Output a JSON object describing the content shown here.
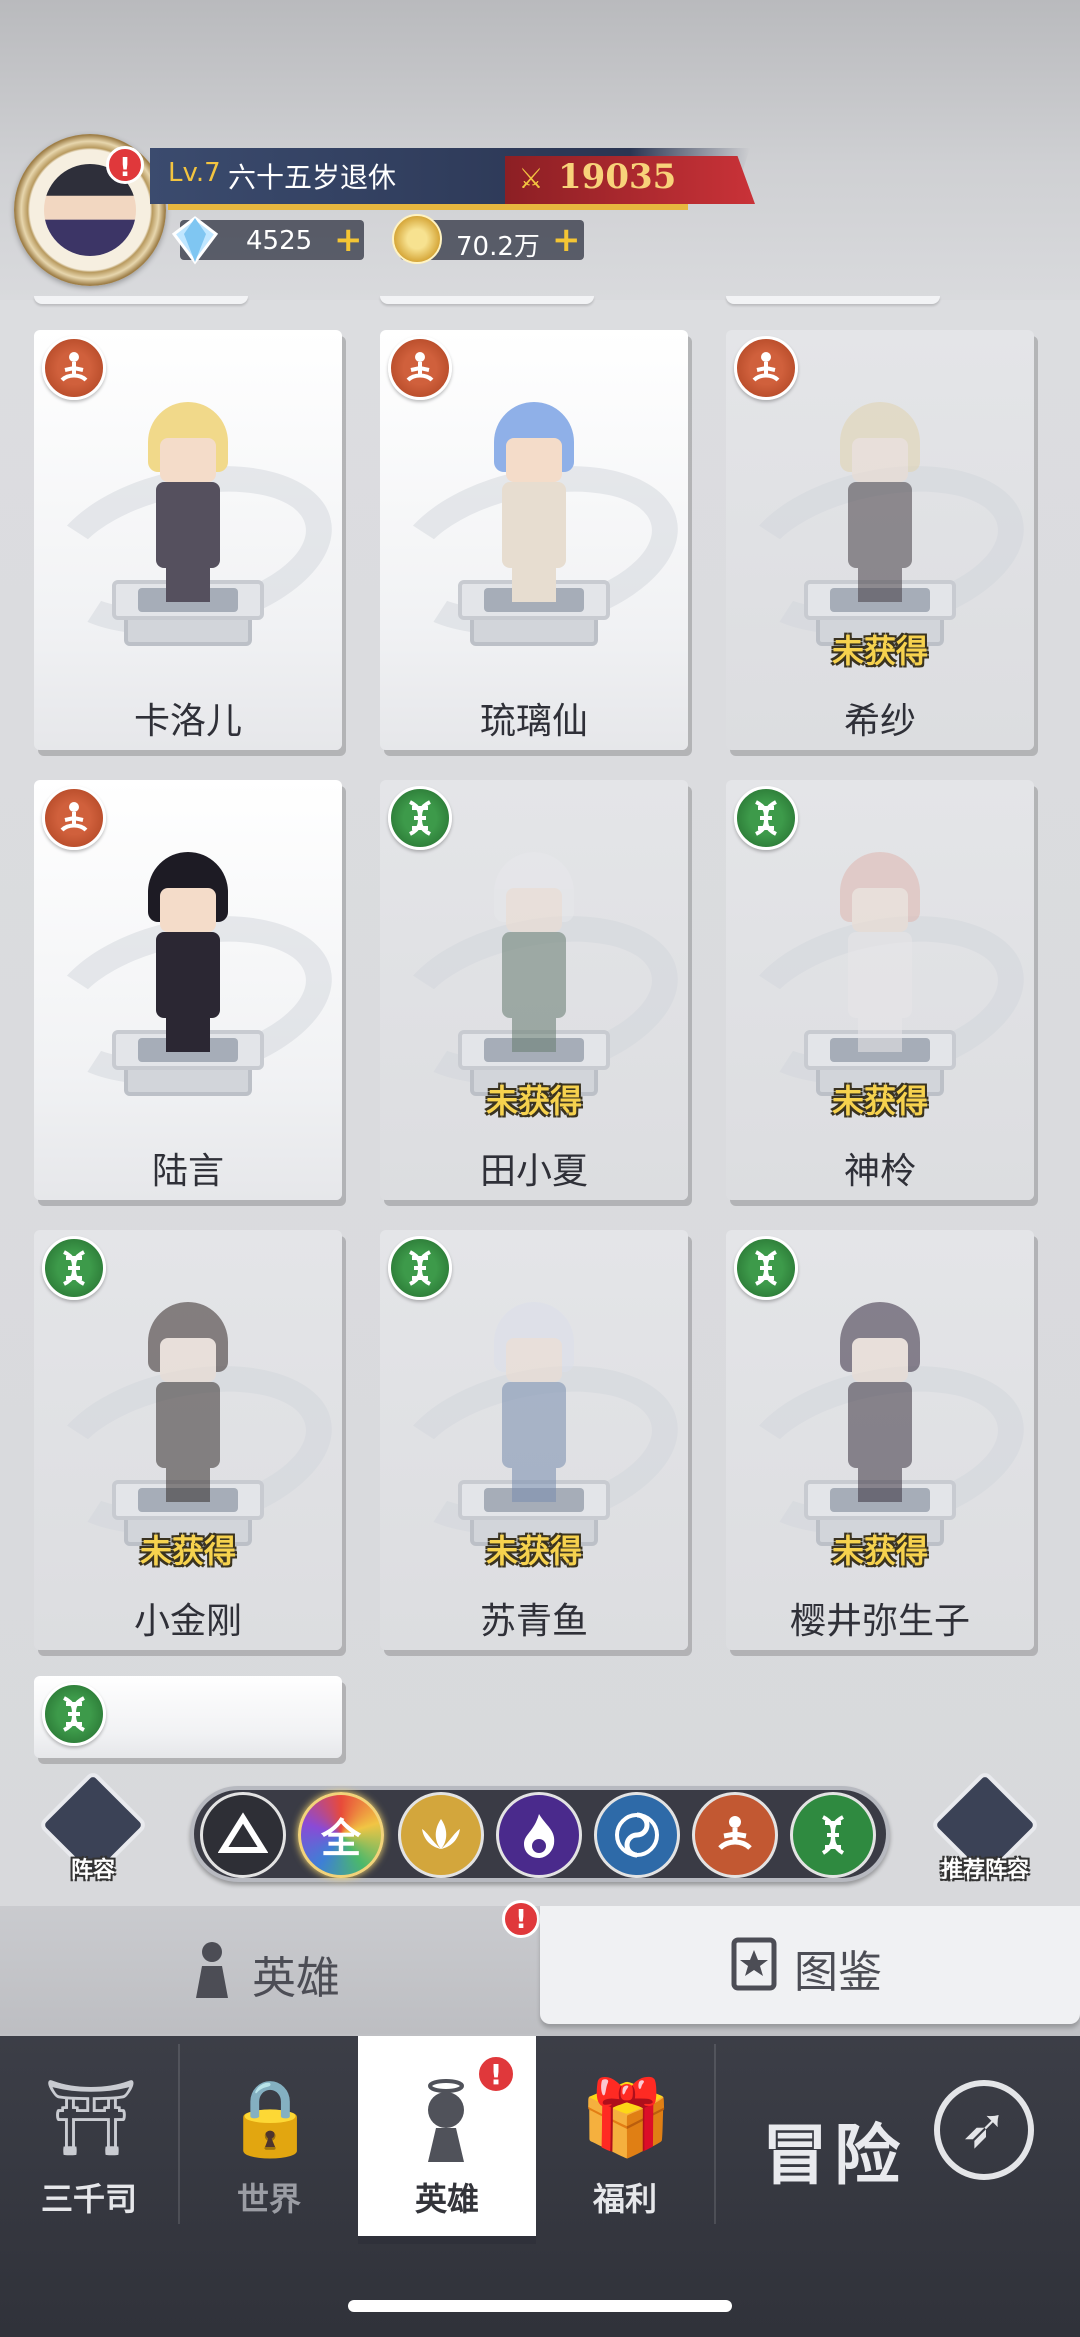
{
  "player": {
    "level": "Lv.7",
    "name": "六十五岁退休",
    "power": "19035",
    "alert": "!",
    "diamonds": "4525",
    "gold": "70.2万",
    "plus": "+"
  },
  "heroes": [
    {
      "name": "卡洛儿",
      "faction": "fire",
      "status": "",
      "locked": false,
      "hair": "#f1d98a",
      "outfit": "#55505e"
    },
    {
      "name": "琉璃仙",
      "faction": "fire",
      "status": "",
      "locked": false,
      "hair": "#8fb0e8",
      "outfit": "#e7ddd0"
    },
    {
      "name": "希纱",
      "faction": "fire",
      "status": "未获得",
      "locked": true,
      "hair": "#e8d39b",
      "outfit": "#4a3f49"
    },
    {
      "name": "陆言",
      "faction": "fire",
      "status": "",
      "locked": false,
      "hair": "#1d1b24",
      "outfit": "#2b2733"
    },
    {
      "name": "田小夏",
      "faction": "dna",
      "status": "未获得",
      "locked": true,
      "hair": "#e6e8ec",
      "outfit": "#5e7f6c"
    },
    {
      "name": "神柃",
      "faction": "dna",
      "status": "未获得",
      "locked": true,
      "hair": "#f0b3a7",
      "outfit": "#e9e6ea"
    },
    {
      "name": "小金刚",
      "faction": "dna",
      "status": "未获得",
      "locked": true,
      "hair": "#3b2a28",
      "outfit": "#3a2f2e"
    },
    {
      "name": "苏青鱼",
      "faction": "dna",
      "status": "未获得",
      "locked": true,
      "hair": "#d9dff0",
      "outfit": "#6f8fc2"
    },
    {
      "name": "樱井弥生子",
      "faction": "dna",
      "status": "未获得",
      "locked": true,
      "hair": "#3d2c4a",
      "outfit": "#3f3347"
    }
  ],
  "filters": {
    "lineup_label": "阵容",
    "recommend_label": "推荐阵容",
    "all_label": "全"
  },
  "tabs": {
    "hero": "英雄",
    "codex": "图鉴",
    "alert": "!"
  },
  "nav": {
    "sanqiansi": "三千司",
    "world": "世界",
    "hero": "英雄",
    "welfare": "福利",
    "adventure": "冒险",
    "alert": "!"
  }
}
